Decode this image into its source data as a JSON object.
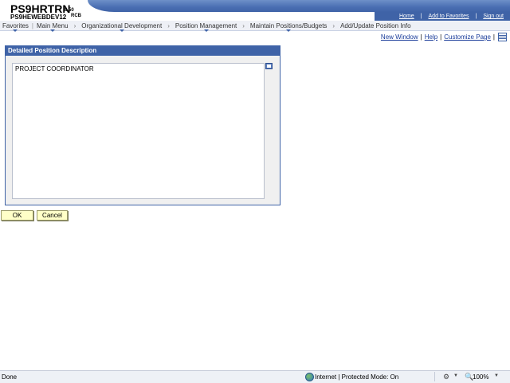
{
  "header": {
    "title": "PS9HRTRN",
    "version": "8.50",
    "database": "PS9HEWEBDEV12",
    "user": "RCB",
    "links": {
      "home": "Home",
      "add_to_favorites": "Add to Favorites",
      "sign_out": "Sign out"
    }
  },
  "menu": {
    "favorites": "Favorites",
    "main_menu": "Main Menu",
    "breadcrumbs": [
      "Organizational Development",
      "Position Management",
      "Maintain Positions/Budgets",
      "Add/Update Position Info"
    ]
  },
  "page_links": {
    "new_window": "New Window",
    "help": "Help",
    "customize_page": "Customize Page"
  },
  "groupbox": {
    "title": "Detailed Position Description",
    "text_value": "PROJECT COORDINATOR"
  },
  "buttons": {
    "ok": "OK",
    "cancel": "Cancel"
  },
  "statusbar": {
    "status": "Done",
    "zone": "Internet | Protected Mode: On",
    "zoom": "100%"
  },
  "icons": {
    "expand": "expand-textarea-icon",
    "grid": "personalize-grid-icon",
    "globe": "globe-icon",
    "tools": "tools-icon",
    "zoom": "zoom-icon"
  }
}
